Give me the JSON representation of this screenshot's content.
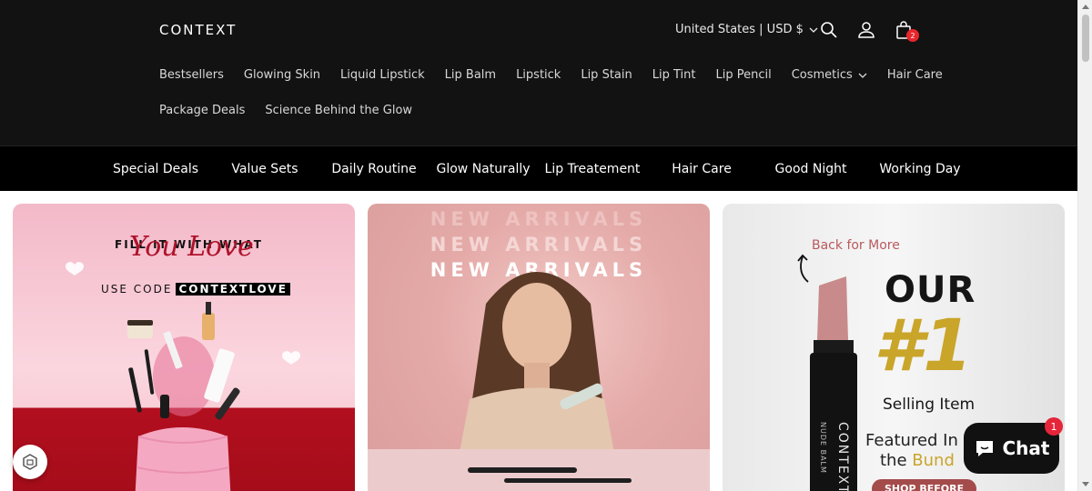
{
  "header": {
    "logo": "CONTEXT",
    "locale_label": "United States | USD $",
    "cart_count": "2",
    "nav_row1": [
      "Bestsellers",
      "Glowing Skin",
      "Liquid Lipstick",
      "Lip Balm",
      "Lipstick",
      "Lip Stain",
      "Lip Tint",
      "Lip Pencil",
      "Cosmetics",
      "Hair Care"
    ],
    "nav_row2": [
      "Package Deals",
      "Science Behind the Glow"
    ]
  },
  "category_bar": [
    "Special Deals",
    "Value Sets",
    "Daily Routine",
    "Glow Naturally",
    "Lip Treatement",
    "Hair Care",
    "Good Night",
    "Working Day"
  ],
  "banners": {
    "b1": {
      "line1": "FILL IT WITH WHAT",
      "script": "You Love",
      "code_prefix": "USE CODE",
      "code": "CONTEXTLOVE"
    },
    "b2": {
      "line": "NEW ARRIVALS"
    },
    "b3": {
      "back": "Back for More",
      "our": "OUR",
      "num": "#1",
      "selling": "Selling Item",
      "featured": "Featured In",
      "bundle_prefix": "the",
      "bundle_word": "Bund",
      "shop": "SHOP BEFORE",
      "product_text": "CONTEXT",
      "product_sub": "NUDE BALM"
    }
  },
  "chat": {
    "label": "Chat",
    "badge": "1"
  },
  "colors": {
    "header_bg": "#121212",
    "catbar_bg": "#000000",
    "accent_red": "#e8262c",
    "gold": "#c9a52a"
  }
}
